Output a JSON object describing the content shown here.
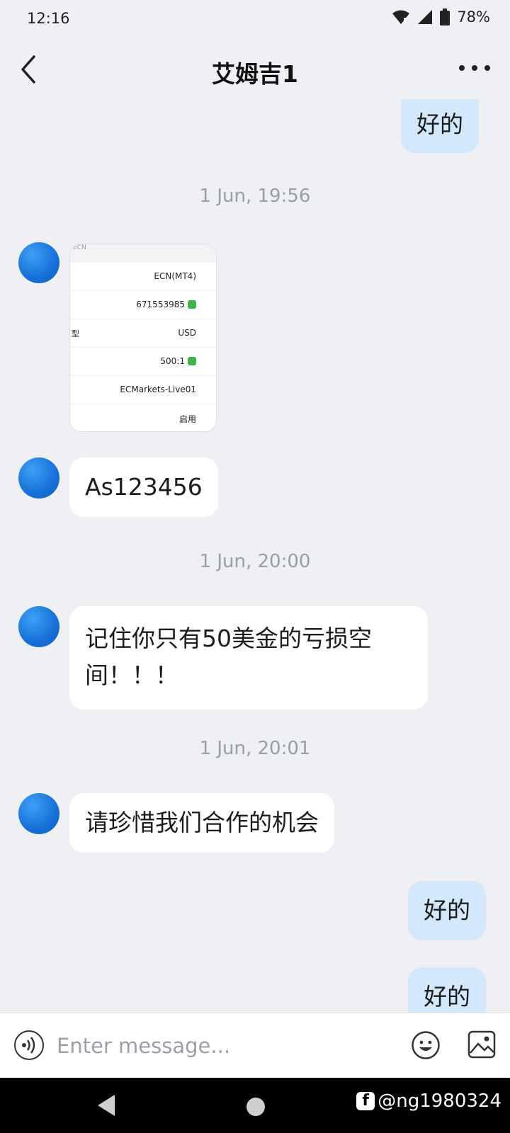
{
  "status_bar": {
    "time": "12:16",
    "battery": "78%"
  },
  "header": {
    "title": "艾姆吉1"
  },
  "messages": {
    "m1": "好的",
    "ts1": "1 Jun, 19:56",
    "image": {
      "top": "ECN",
      "rows": [
        {
          "label": "",
          "value": "ECN(MT4)"
        },
        {
          "label": "",
          "value": "671553985"
        },
        {
          "label": "型",
          "value": "USD"
        },
        {
          "label": "",
          "value": "500:1"
        },
        {
          "label": "",
          "value": "ECMarkets-Live01"
        },
        {
          "label": "",
          "value": "启用"
        }
      ]
    },
    "m2": "As123456",
    "ts2": "1 Jun, 20:00",
    "m3_line1": "记住你只有50美金的亏损空",
    "m3_line2": "间！！！",
    "ts3": "1 Jun, 20:01",
    "m4": "请珍惜我们合作的机会",
    "m5": "好的",
    "m6": "好的"
  },
  "input": {
    "placeholder": "Enter message..."
  },
  "watermark": {
    "text": "@ng1980324"
  }
}
